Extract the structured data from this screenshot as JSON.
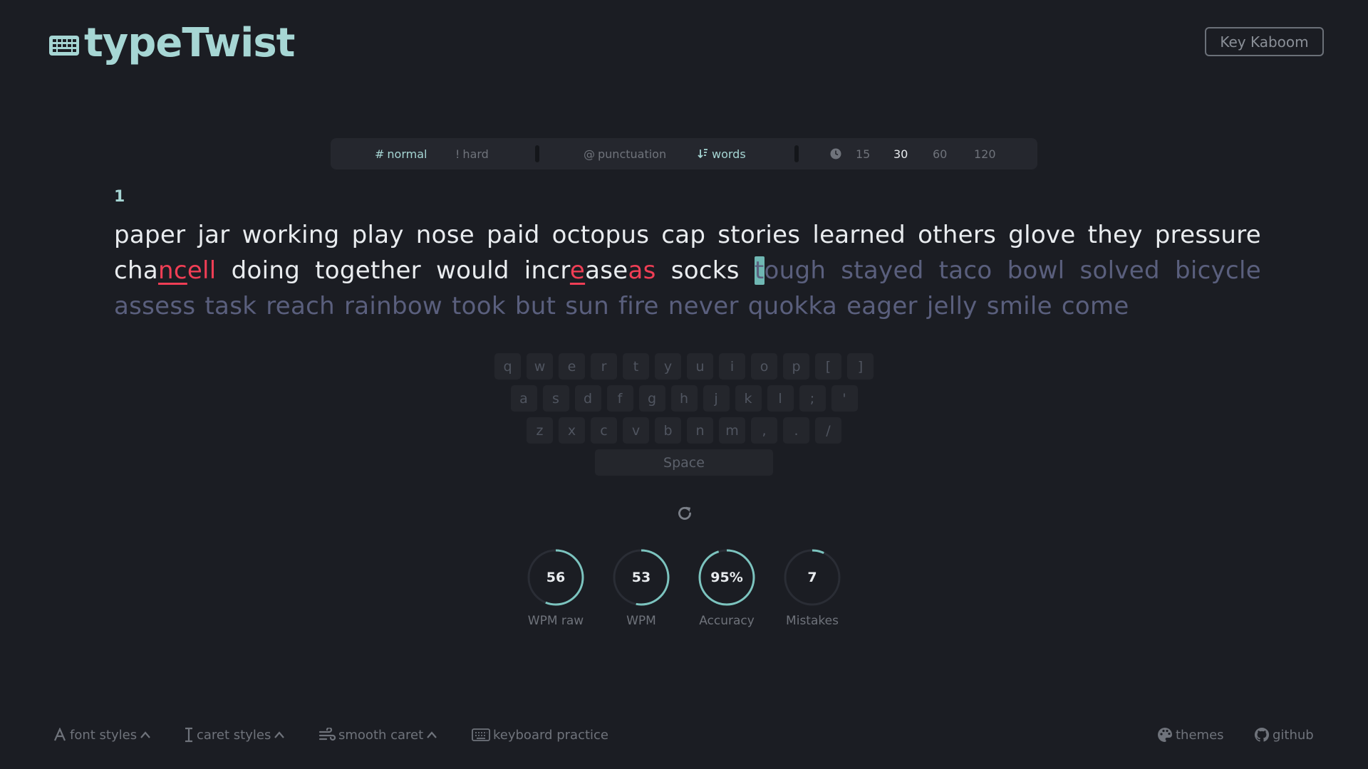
{
  "header": {
    "logo_text": "typeTwist",
    "top_button": "Key Kaboom"
  },
  "config": {
    "difficulty": [
      {
        "label": "normal",
        "icon": "hash-icon",
        "active": true
      },
      {
        "label": "hard",
        "icon": "exclamation-icon",
        "active": false
      }
    ],
    "modes": [
      {
        "label": "punctuation",
        "icon": "at-icon",
        "active": false
      },
      {
        "label": "words",
        "icon": "sort-icon",
        "active": true
      }
    ],
    "time_icon": "clock-icon",
    "times": [
      {
        "label": "15",
        "active": false
      },
      {
        "label": "30",
        "active": true
      },
      {
        "label": "60",
        "active": false
      },
      {
        "label": "120",
        "active": false
      }
    ]
  },
  "test": {
    "counter": "1",
    "line1": [
      "paper",
      "jar",
      "working",
      "play",
      "nose",
      "paid",
      "octopus",
      "cap",
      "stories",
      "learned",
      "others",
      "glove",
      "they",
      "pressure"
    ],
    "line2": {
      "chancell": {
        "a": "cha",
        "b": "nc",
        "c": "ell"
      },
      "doing": "doing",
      "together": "together",
      "would": "would",
      "increaseas": {
        "a": "incr",
        "b": "e",
        "c": "ase",
        "d": "as"
      },
      "socks": "socks",
      "tough": {
        "caret": "t",
        "rest": "ough"
      },
      "todo": [
        "stayed",
        "taco",
        "bowl",
        "solved",
        "bicycle"
      ]
    },
    "line3": [
      "assess",
      "task",
      "reach",
      "rainbow",
      "took",
      "but",
      "sun",
      "fire",
      "never",
      "quokka",
      "eager",
      "jelly",
      "smile",
      "come"
    ]
  },
  "keyboard": {
    "row1": [
      "q",
      "w",
      "e",
      "r",
      "t",
      "y",
      "u",
      "i",
      "o",
      "p",
      "[",
      "]"
    ],
    "row2": [
      "a",
      "s",
      "d",
      "f",
      "g",
      "h",
      "j",
      "k",
      "l",
      ";",
      "'"
    ],
    "row3": [
      "z",
      "x",
      "c",
      "v",
      "b",
      "n",
      "m",
      ",",
      ".",
      "/"
    ],
    "space": "Space"
  },
  "stats": {
    "wpm_raw": {
      "value": "56",
      "label": "WPM raw",
      "fraction": 0.56
    },
    "wpm": {
      "value": "53",
      "label": "WPM",
      "fraction": 0.53
    },
    "accuracy": {
      "value": "95%",
      "label": "Accuracy",
      "fraction": 0.95
    },
    "mistakes": {
      "value": "7",
      "label": "Mistakes",
      "fraction": 0.07
    }
  },
  "footer": {
    "font_styles": "font styles",
    "caret_styles": "caret styles",
    "smooth_caret": "smooth caret",
    "keyboard_practice": "keyboard practice",
    "themes": "themes",
    "github": "github"
  },
  "colors": {
    "accent": "#a6d6d4",
    "ring": "#7cc4bf",
    "error": "#f03e55",
    "pending": "#5a5f7d",
    "background": "#1b1d23"
  }
}
